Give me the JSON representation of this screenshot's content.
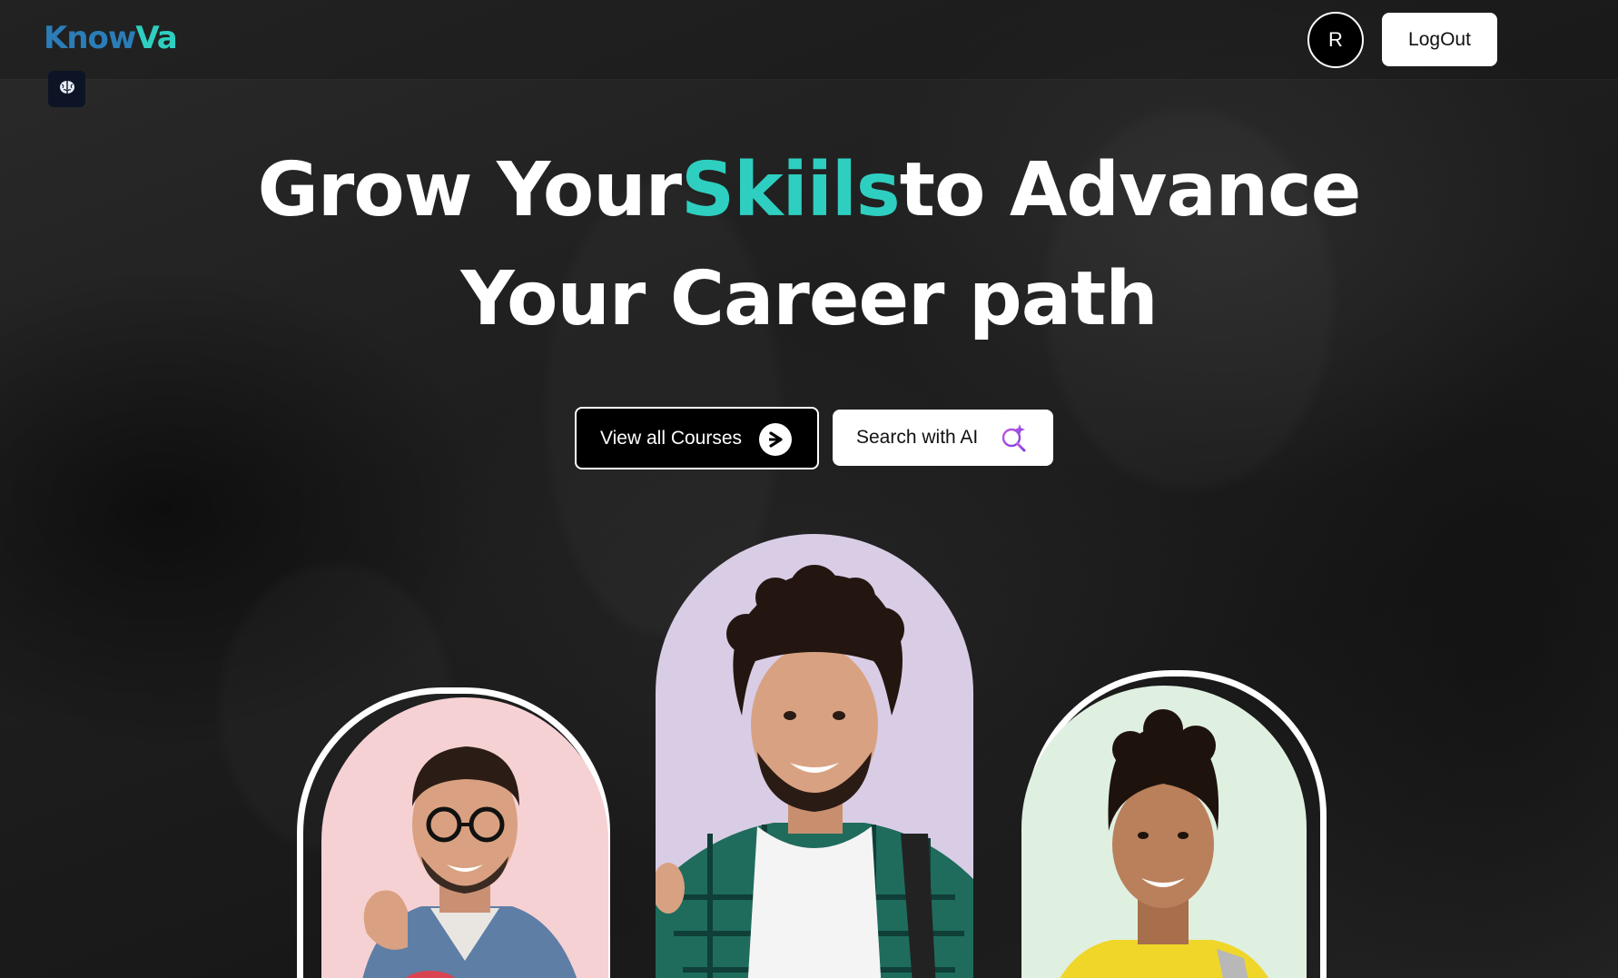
{
  "header": {
    "logo_part1": "Know",
    "logo_part2": "Va",
    "ai_chip_icon": "brain-icon",
    "avatar_initial": "R",
    "logout_label": "LogOut"
  },
  "hero": {
    "line1_before": "Grow Your",
    "line1_accent": "Skiils",
    "line1_after": "to Advance",
    "line2": "Your Career path",
    "accent_color": "#2ecfc0"
  },
  "buttons": {
    "courses_label": "View all Courses",
    "courses_icon": "arrow-right-circle-icon",
    "ai_label": "Search with AI",
    "ai_icon": "ai-search-sparkle-icon"
  },
  "portraits": [
    {
      "name": "student-glasses",
      "bg": "#f6d1d3"
    },
    {
      "name": "student-curly-hair",
      "bg": "#d9cde6"
    },
    {
      "name": "student-yellow-shirt",
      "bg": "#dff0e1"
    }
  ]
}
